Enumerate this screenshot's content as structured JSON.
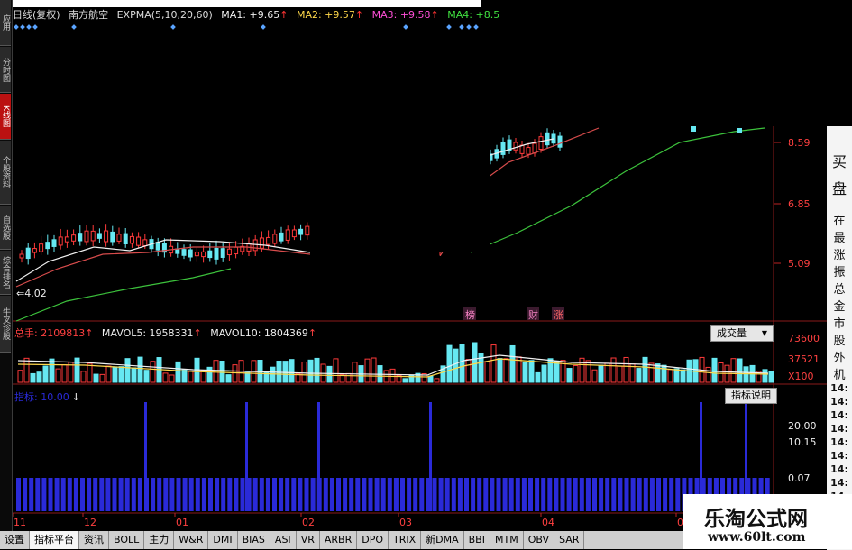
{
  "header": {
    "period": "日线(复权)",
    "stock_name": "南方航空",
    "indicator": "EXPMA(5,10,20,60)",
    "ma1": "MA1: +9.65",
    "ma2": "MA2: +9.57",
    "ma3": "MA3: +9.58",
    "ma4": "MA4: +8.5",
    "arrow_up": "↑"
  },
  "sidebar": {
    "tabs": [
      "应用",
      "分时图",
      "K线图",
      "个股资料",
      "自选股",
      "综合排名",
      "牛叉诊股"
    ]
  },
  "price_axis": {
    "labels": [
      "8.59",
      "6.85",
      "5.09"
    ]
  },
  "annotations": {
    "low_mark": "4.02",
    "markers": [
      "榜",
      "财",
      "涨"
    ]
  },
  "volume_panel": {
    "total_label": "总手: 2109813",
    "mavol5_label": "MAVOL5: 1958331",
    "mavol10_label": "MAVOL10: 1804369",
    "arrow_up": "↑",
    "selector": "成交量",
    "axis": [
      "73600",
      "37521",
      "X100"
    ]
  },
  "indicator_panel": {
    "label": "指标: 10.00",
    "help_button": "指标说明",
    "axis": [
      "20.00",
      "10.15",
      "0.07"
    ]
  },
  "date_axis": {
    "labels": [
      "11",
      "12",
      "01",
      "02",
      "03",
      "04",
      "0"
    ]
  },
  "right_panel": {
    "buy": "买",
    "plate": "盘",
    "labels": [
      "在",
      "最",
      "涨",
      "振",
      "总",
      "金",
      "市",
      "股",
      "外",
      "机"
    ],
    "times": [
      "14:",
      "14:",
      "14:",
      "14:",
      "14:",
      "14:",
      "14:",
      "14:",
      "14:",
      "14:",
      "14:",
      "14:"
    ]
  },
  "bottom_tabs": [
    "设置",
    "指标平台",
    "资讯",
    "BOLL",
    "主力",
    "W&R",
    "DMI",
    "BIAS",
    "ASI",
    "VR",
    "ARBR",
    "DPO",
    "TRIX",
    "新DMA",
    "BBI",
    "MTM",
    "OBV",
    "SAR"
  ],
  "watermark": {
    "title": "乐淘公式网",
    "url": "www.60lt.com"
  },
  "colors": {
    "up": "#ff3a3a",
    "down": "#66e8f2",
    "ma_white": "#f0f0f0",
    "ma_red": "#d84c4c",
    "ma_green": "#3cc23c",
    "indicator_blue": "#2a2ad8"
  }
}
